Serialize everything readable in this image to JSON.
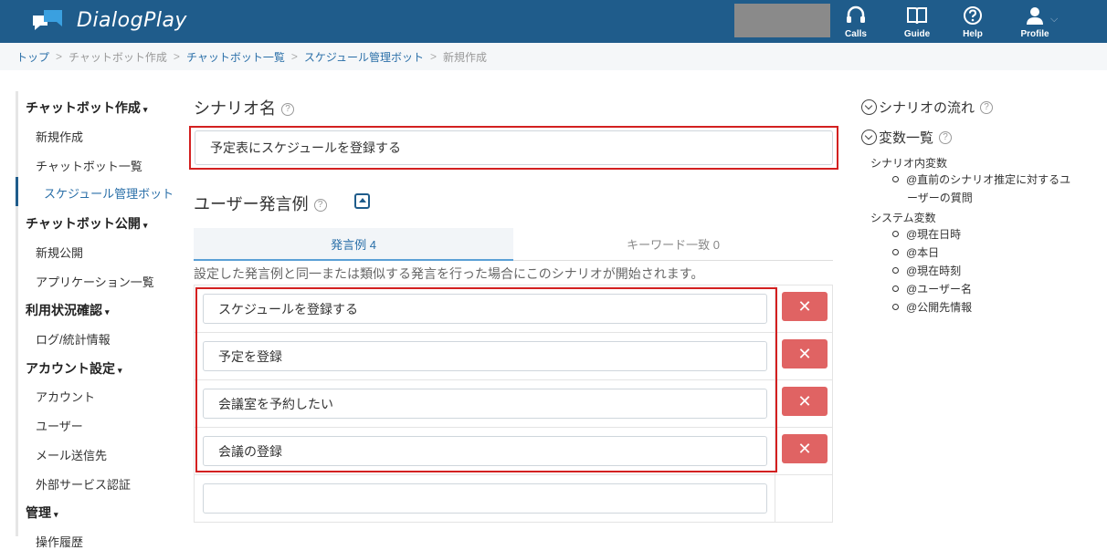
{
  "header": {
    "app_name": "DialogPlay",
    "nav": [
      {
        "label": "Calls",
        "icon": "headset-icon"
      },
      {
        "label": "Guide",
        "icon": "book-icon"
      },
      {
        "label": "Help",
        "icon": "question-icon"
      },
      {
        "label": "Profile",
        "icon": "user-icon"
      }
    ],
    "colors": {
      "bar": "#1f5c8b",
      "accent": "#2a6fa8",
      "danger": "#e06363",
      "highlight": "#d32020"
    }
  },
  "breadcrumb": [
    "トップ",
    "チャットボット作成",
    "チャットボット一覧",
    "スケジュール管理ボット",
    "新規作成"
  ],
  "sidebar": {
    "groups": [
      {
        "title": "チャットボット作成",
        "items": [
          "新規作成",
          "チャットボット一覧",
          "スケジュール管理ボット"
        ]
      },
      {
        "title": "チャットボット公開",
        "items": [
          "新規公開",
          "アプリケーション一覧"
        ]
      },
      {
        "title": "利用状況確認",
        "items": [
          "ログ/統計情報"
        ]
      },
      {
        "title": "アカウント設定",
        "items": [
          "アカウント",
          "ユーザー",
          "メール送信先",
          "外部サービス認証"
        ]
      },
      {
        "title": "管理",
        "items": [
          "操作履歴"
        ]
      }
    ],
    "caret": "▾"
  },
  "main": {
    "scenario_label": "シナリオ名",
    "help_mark": "?",
    "scenario_name": "予定表にスケジュールを登録する",
    "utterance_label": "ユーザー発言例",
    "tabs": [
      {
        "label": "発言例 4",
        "active": true
      },
      {
        "label": "キーワード一致 0",
        "active": false
      }
    ],
    "description": "設定した発言例と同一または類似する発言を行った場合にこのシナリオが開始されます。",
    "examples": [
      "スケジュールを登録する",
      "予定を登録",
      "会議室を予約したい",
      "会議の登録"
    ],
    "new_example": "",
    "delete_symbol": "✕"
  },
  "right_panel": {
    "flow_title": "シナリオの流れ",
    "vars_title": "変数一覧",
    "scenario_vars_label": "シナリオ内変数",
    "scenario_vars": [
      "@直前のシナリオ推定に対するユ",
      "ーザーの質問"
    ],
    "system_vars_label": "システム変数",
    "system_vars": [
      "@現在日時",
      "@本日",
      "@現在時刻",
      "@ユーザー名",
      "@公開先情報"
    ]
  }
}
